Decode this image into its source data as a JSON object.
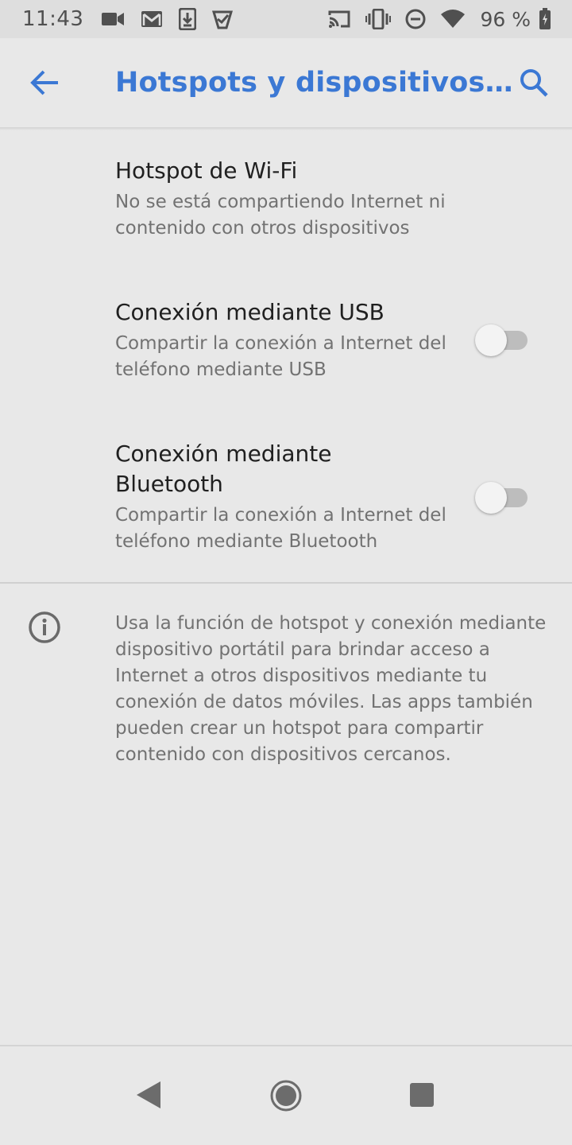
{
  "status_bar": {
    "time": "11:43",
    "battery_percent": "96 %",
    "icons_left": [
      "video-camera-icon",
      "gmail-icon",
      "download-icon",
      "check-badge-icon"
    ],
    "icons_right": [
      "cast-icon",
      "vibrate-icon",
      "do-not-disturb-icon",
      "wifi-icon",
      "battery-icon"
    ]
  },
  "app_bar": {
    "title": "Hotspots y dispositivos…",
    "back_icon": "arrow-back-icon",
    "search_icon": "search-icon",
    "accent_color": "#3b78d4"
  },
  "preferences": [
    {
      "title": "Hotspot de Wi-Fi",
      "summary": "No se está compartiendo Internet ni contenido con otros dispositivos",
      "has_switch": false
    },
    {
      "title": "Conexión mediante USB",
      "summary": "Compartir la conexión a Internet del teléfono mediante USB",
      "has_switch": true,
      "switch_on": false
    },
    {
      "title": "Conexión mediante Bluetooth",
      "summary": "Compartir la conexión a Internet del teléfono mediante Bluetooth",
      "has_switch": true,
      "switch_on": false
    }
  ],
  "info": {
    "icon": "info-icon",
    "text": "Usa la función de hotspot y conexión mediante dispositivo portátil para brindar acceso a Internet a otros dispositivos mediante tu conexión de datos móviles. Las apps también pueden crear un hotspot para compartir contenido con dispositivos cercanos."
  },
  "nav_bar": {
    "buttons": [
      "nav-back-icon",
      "nav-home-icon",
      "nav-recents-icon"
    ]
  }
}
